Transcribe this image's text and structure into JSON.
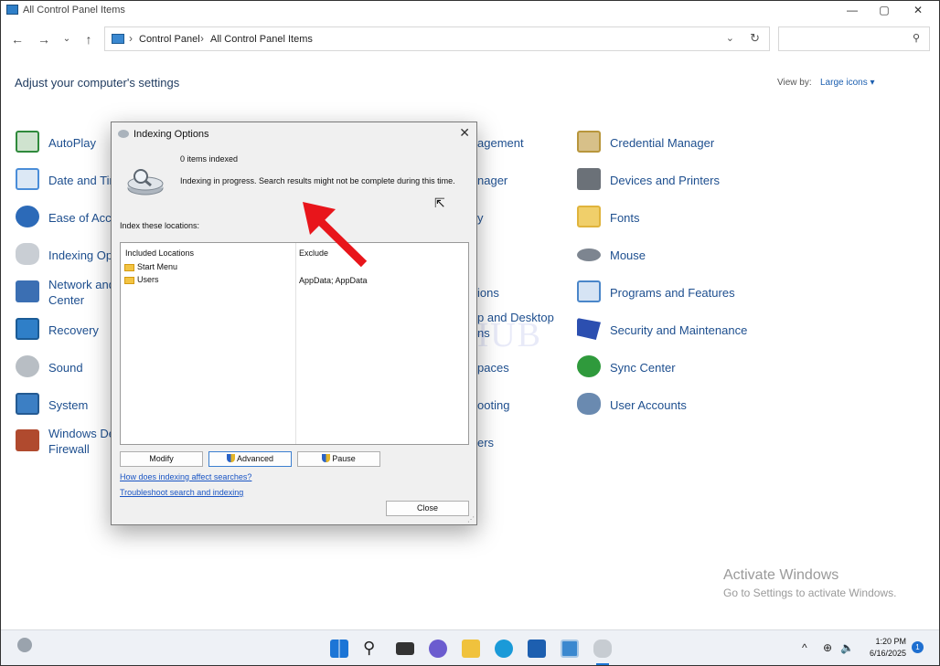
{
  "window": {
    "title": "All Control Panel Items",
    "minimize": "—",
    "maximize": "▢",
    "close": "✕"
  },
  "address": {
    "crumbs": [
      "Control Panel",
      "All Control Panel Items"
    ],
    "search_placeholder": ""
  },
  "page": {
    "heading": "Adjust your computer's settings",
    "view_by_label": "View by:",
    "view_by_value": "Large icons ▾"
  },
  "items_col1": [
    {
      "label": "AutoPlay",
      "color": "#2f8a3c"
    },
    {
      "label": "Date and Tir",
      "color": "#4a8dd8"
    },
    {
      "label": "Ease of Acce",
      "color": "#2c6ab8"
    },
    {
      "label": "Indexing Op",
      "color": "#8c96a0"
    },
    {
      "label": "Network and",
      "label2": "Center",
      "color": "#3b6fb3"
    },
    {
      "label": "Recovery",
      "color": "#2f7fc8"
    },
    {
      "label": "Sound",
      "color": "#9aa0a6"
    },
    {
      "label": "System",
      "color": "#3c7fc4"
    },
    {
      "label": "Windows De",
      "label2": "Firewall",
      "color": "#b04a2e"
    }
  ],
  "items_col2": [
    {
      "label": "agement"
    },
    {
      "label": "nager"
    },
    {
      "label": "y"
    },
    {
      "label": ""
    },
    {
      "label": "ions"
    },
    {
      "label": "p and Desktop",
      "label2": "ns"
    },
    {
      "label": "paces"
    },
    {
      "label": "ooting"
    },
    {
      "label": "ers"
    }
  ],
  "items_col3": [
    {
      "label": "Credential Manager",
      "color": "#b8963c"
    },
    {
      "label": "Devices and Printers",
      "color": "#6b7178"
    },
    {
      "label": "Fonts",
      "color": "#e0b43c"
    },
    {
      "label": "Mouse",
      "color": "#7d8590"
    },
    {
      "label": "Programs and Features",
      "color": "#4a86c9"
    },
    {
      "label": "Security and Maintenance",
      "color": "#2c4fb0"
    },
    {
      "label": "Sync Center",
      "color": "#2f9a3c"
    },
    {
      "label": "User Accounts",
      "color": "#6a8ab0"
    }
  ],
  "dialog": {
    "title": "Indexing Options",
    "items_indexed": "0 items indexed",
    "status": "Indexing in progress. Search results might not be complete during this time.",
    "index_locations_label": "Index these locations:",
    "col_included": "Included Locations",
    "col_exclude": "Exclude",
    "rows": [
      {
        "location": "Start Menu",
        "exclude": ""
      },
      {
        "location": "Users",
        "exclude": "AppData; AppData"
      }
    ],
    "modify": "Modify",
    "advanced": "Advanced",
    "pause": "Pause",
    "link_affect": "How does indexing affect searches?",
    "link_troubleshoot": "Troubleshoot search and indexing",
    "close_button": "Close"
  },
  "watermark": "IT Pros HUB",
  "activation": {
    "title": "Activate Windows",
    "subtitle": "Go to Settings to activate Windows."
  },
  "taskbar": {
    "time": "1:20 PM",
    "date": "6/16/2025",
    "notifications": "1"
  }
}
